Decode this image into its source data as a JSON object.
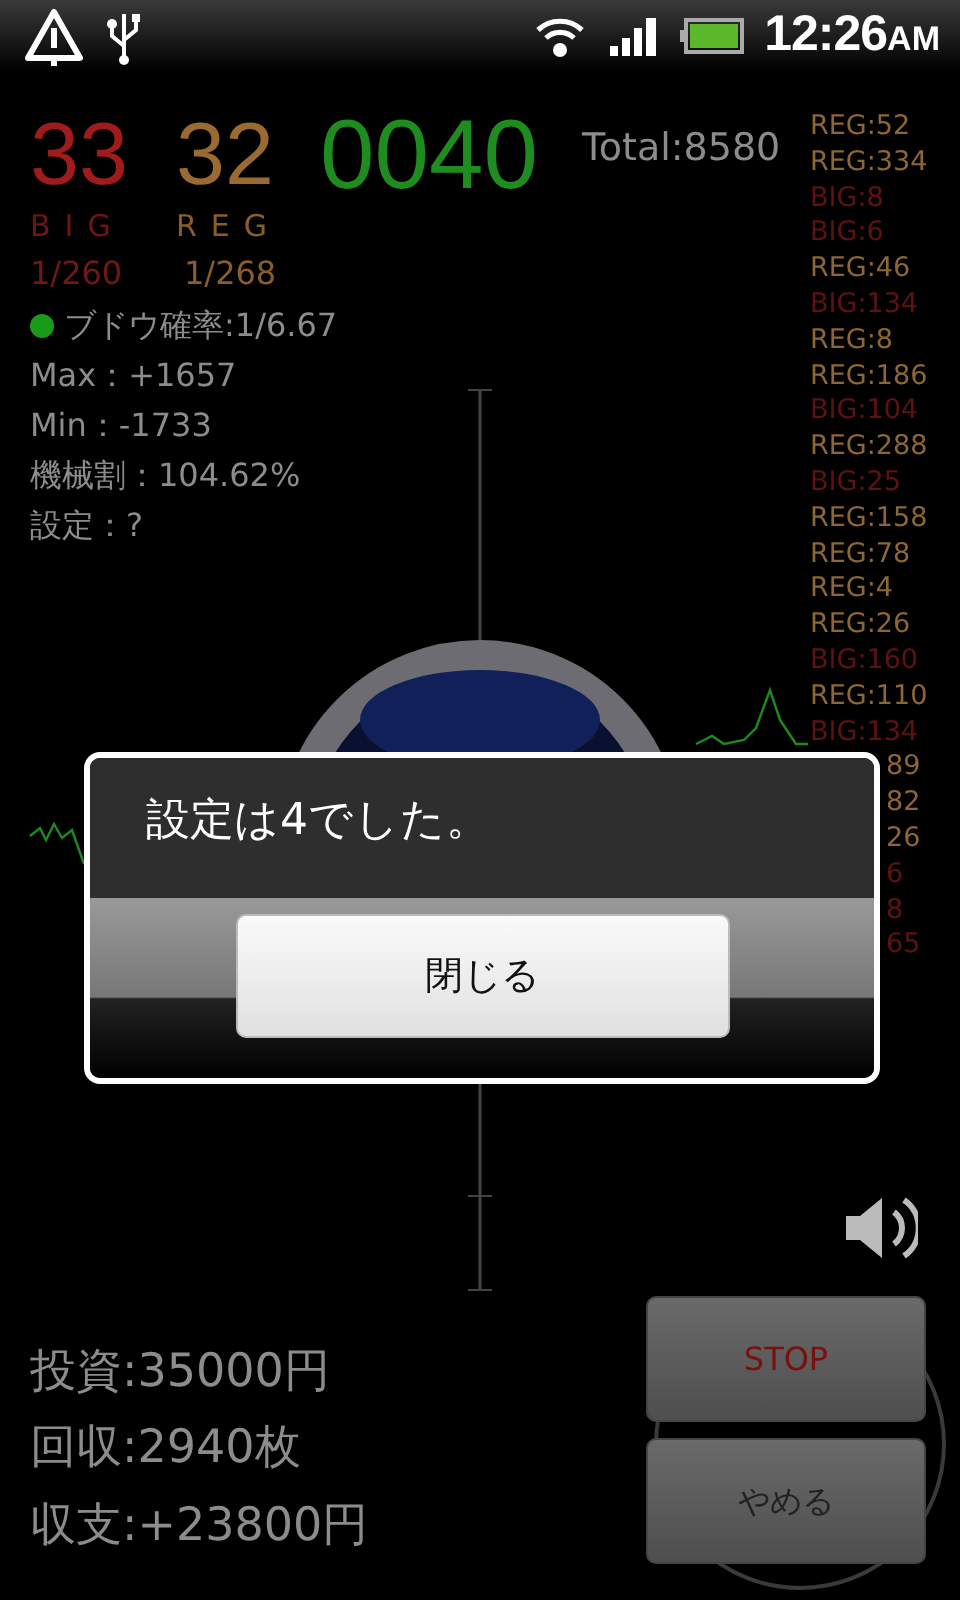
{
  "status_bar": {
    "time": "12:26",
    "ampm": "AM"
  },
  "counters": {
    "big": "33",
    "big_label": "BIG",
    "big_rate": "1/260",
    "reg": "32",
    "reg_label": "REG",
    "reg_rate": "1/268",
    "games": "0040",
    "total": "Total:8580"
  },
  "stats": [
    {
      "text": "ブドウ確率:1/6.67",
      "color": "#1a9a1a"
    },
    {
      "text": "Max：+1657"
    },
    {
      "text": "Min：-1733"
    },
    {
      "text": "機械割：104.62%"
    },
    {
      "text": "設定：?"
    }
  ],
  "history": [
    {
      "kind": "reg",
      "text": "REG:52",
      "cut": false
    },
    {
      "kind": "reg",
      "text": "REG:334",
      "cut": false
    },
    {
      "kind": "big",
      "text": "BIG:8",
      "cut": false
    },
    {
      "kind": "big",
      "text": "BIG:6",
      "cut": false
    },
    {
      "kind": "reg",
      "text": "REG:46",
      "cut": false
    },
    {
      "kind": "big",
      "text": "BIG:134",
      "cut": false
    },
    {
      "kind": "reg",
      "text": "REG:8",
      "cut": false
    },
    {
      "kind": "reg",
      "text": "REG:186",
      "cut": false
    },
    {
      "kind": "big",
      "text": "BIG:104",
      "cut": false
    },
    {
      "kind": "reg",
      "text": "REG:288",
      "cut": false
    },
    {
      "kind": "big",
      "text": "BIG:25",
      "cut": false
    },
    {
      "kind": "reg",
      "text": "REG:158",
      "cut": false
    },
    {
      "kind": "reg",
      "text": "REG:78",
      "cut": false
    },
    {
      "kind": "reg",
      "text": "REG:4",
      "cut": false
    },
    {
      "kind": "reg",
      "text": "REG:26",
      "cut": false
    },
    {
      "kind": "big",
      "text": "BIG:160",
      "cut": false
    },
    {
      "kind": "reg",
      "text": "REG:110",
      "cut": false
    },
    {
      "kind": "big",
      "text": "BIG:134",
      "cut": false
    },
    {
      "kind": "reg",
      "text": "89",
      "cut": true
    },
    {
      "kind": "reg",
      "text": "82",
      "cut": true
    },
    {
      "kind": "reg",
      "text": "26",
      "cut": true
    },
    {
      "kind": "big",
      "text": "6",
      "cut": true
    },
    {
      "kind": "big",
      "text": "8",
      "cut": true
    },
    {
      "kind": "big",
      "text": "65",
      "cut": true
    }
  ],
  "totals": [
    "投資:35000円",
    "回収:2940枚",
    "収支:+23800円"
  ],
  "buttons": [
    {
      "kind": "stop",
      "label": "STOP"
    },
    {
      "kind": "plain",
      "label": "やめる"
    }
  ],
  "dialog": {
    "message": "設定は4でした。",
    "button": "閉じる"
  }
}
